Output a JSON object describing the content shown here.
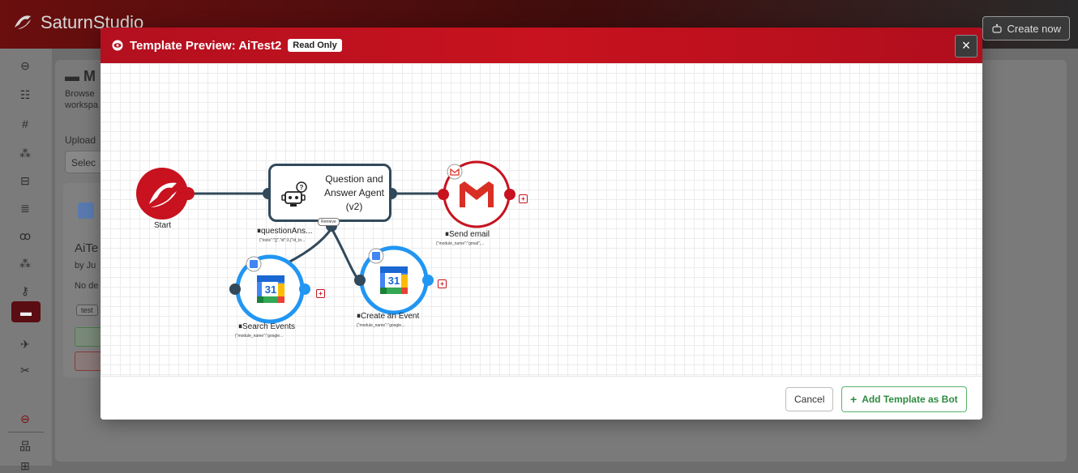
{
  "app": {
    "name": "SaturnStudio",
    "create_label": "Create now"
  },
  "background": {
    "letter_m": "M",
    "browse_text": "Browse",
    "workspace_text": "workspa",
    "upload_label": "Upload",
    "select_text": "Selec",
    "card_title": "AiTe",
    "card_by": "by Ju",
    "card_desc": "No de",
    "card_tag": "test"
  },
  "modal": {
    "title": "Template Preview: AiTest2",
    "badge": "Read Only",
    "close_label": "×",
    "cancel_label": "Cancel",
    "add_label": "Add Template as Bot",
    "add_icon": "+"
  },
  "flow": {
    "start": {
      "label": "Start"
    },
    "qa": {
      "title_line1": "Question and",
      "title_line2": "Answer Agent",
      "title_line3": "(v2)",
      "label": "questionAns...",
      "sub": "{\"tools\":\"[]\",\"id\":3,{\"id_to...",
      "badge": "Retrieve"
    },
    "email": {
      "label": "Send email",
      "sub": "{\"module_name\":\"gmail\",..."
    },
    "search": {
      "label": "Search Events",
      "sub": "{\"module_name\":\"google..."
    },
    "create": {
      "label": "Create an Event",
      "sub": "{\"module_name\":\"google..."
    },
    "calendar_number": "31"
  },
  "colors": {
    "brand_red": "#c8121f",
    "node_dark": "#31495a",
    "calendar_blue": "#2196f3",
    "add_green": "#2e8b3e"
  }
}
